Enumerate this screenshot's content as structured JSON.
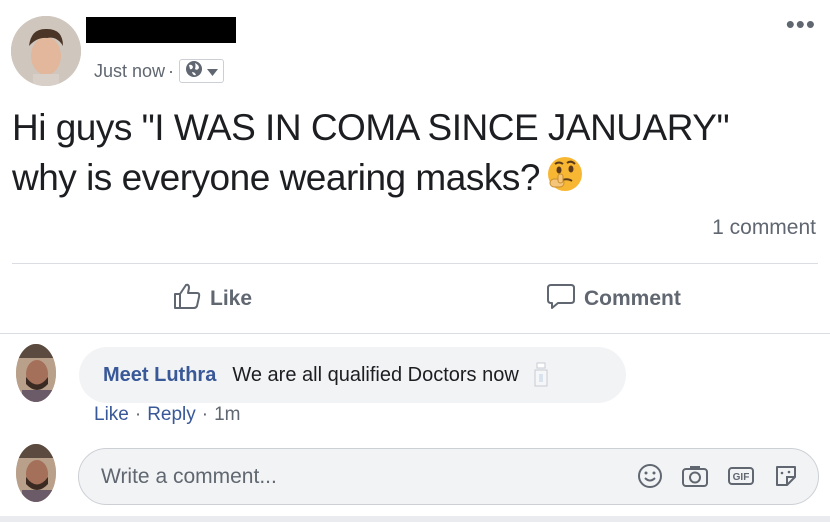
{
  "post": {
    "timestamp": "Just now",
    "separator": "·",
    "privacy_icon": "globe-icon",
    "text_line1": "Hi guys \"I WAS IN COMA SINCE JANUARY\"",
    "text_line2": "why is everyone wearing masks?",
    "emoji": "thinking-face-emoji",
    "comment_count": "1 comment"
  },
  "actions": {
    "like_label": "Like",
    "comment_label": "Comment"
  },
  "comment": {
    "author": "Meet Luthra",
    "text": "We are all qualified Doctors now",
    "like_label": "Like",
    "reply_label": "Reply",
    "time": "1m",
    "separator": "·"
  },
  "composer": {
    "placeholder": "Write a comment...",
    "icons": [
      "emoji-icon",
      "camera-icon",
      "gif-icon",
      "sticker-icon"
    ]
  },
  "colors": {
    "link": "#385898",
    "secondary_text": "#606770",
    "divider": "#dadde1",
    "bubble_bg": "#f2f3f5"
  }
}
